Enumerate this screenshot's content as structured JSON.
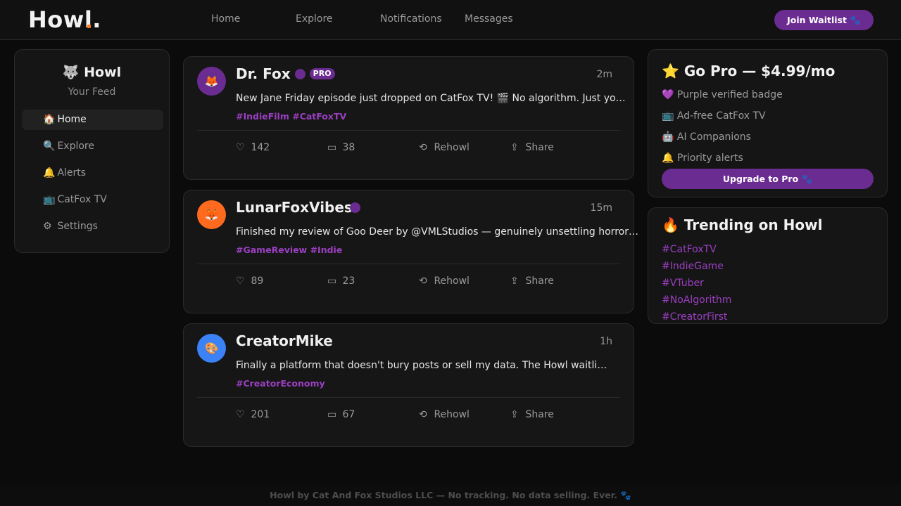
{
  "app": {
    "logo": "Howl",
    "logo_period": "."
  },
  "nav": {
    "links": [
      "Home",
      "Explore",
      "Notifications",
      "Messages"
    ],
    "join_label": "Join Waitlist 🐾"
  },
  "sidebar": {
    "title": "🐺 Howl",
    "subtitle": "Your Feed",
    "items": [
      {
        "icon": "🏠",
        "label": "Home"
      },
      {
        "icon": "🔍",
        "label": "Explore"
      },
      {
        "icon": "🔔",
        "label": "Alerts"
      },
      {
        "icon": "📺",
        "label": "CatFox TV"
      },
      {
        "icon": "⚙",
        "label": "Settings"
      }
    ]
  },
  "feed": [
    {
      "avatar": "🦊",
      "avatar_color": "#6b2c91",
      "username": "Dr. Fox",
      "verified": true,
      "badge": "PRO",
      "time": "2m",
      "text": "New Jane Friday episode just dropped on CatFox TV! 🎬 No algorithm. Just your favorite creators, in order.",
      "tags": "#IndieFilm #CatFoxTV",
      "likes": "142",
      "comments": "38",
      "rehowl": "Rehowl",
      "share": "Share"
    },
    {
      "avatar": "🦊",
      "avatar_color": "#ff6a1f",
      "username": "LunarFoxVibes",
      "verified": true,
      "badge": "",
      "time": "15m",
      "text": "Finished my review of Goo Deer by @VMLStudios — genuinely unsettling horror vibes, go play it.",
      "tags": "#GameReview #Indie",
      "likes": "89",
      "comments": "23",
      "rehowl": "Rehowl",
      "share": "Share"
    },
    {
      "avatar": "🎨",
      "avatar_color": "#3b82f6",
      "username": "CreatorMike",
      "verified": false,
      "badge": "",
      "time": "1h",
      "text": "Finally a platform that doesn't bury posts or sell my data. The Howl waitlist is worth joining.",
      "tags": "#CreatorEconomy",
      "likes": "201",
      "comments": "67",
      "rehowl": "Rehowl",
      "share": "Share"
    }
  ],
  "pro_panel": {
    "title": "⭐ Go Pro — $4.99/mo",
    "perks": [
      "💜 Purple verified badge",
      "📺 Ad-free CatFox TV",
      "🤖 AI Companions",
      "🔔 Priority alerts"
    ],
    "button_label": "Upgrade to Pro 🐾"
  },
  "trending": {
    "title": "🔥 Trending on Howl",
    "tags": [
      "#CatFoxTV",
      "#IndieGame",
      "#VTuber",
      "#NoAlgorithm",
      "#CreatorFirst"
    ]
  },
  "footer": {
    "text": "Howl by Cat And Fox Studios LLC — No tracking. No data selling. Ever. 🐾"
  },
  "colors": {
    "accent_purple": "#6b2c91",
    "tag_purple": "#9a3fc0",
    "logo_dot_orange": "#ff7a1a",
    "background": "#0b0b0b"
  }
}
